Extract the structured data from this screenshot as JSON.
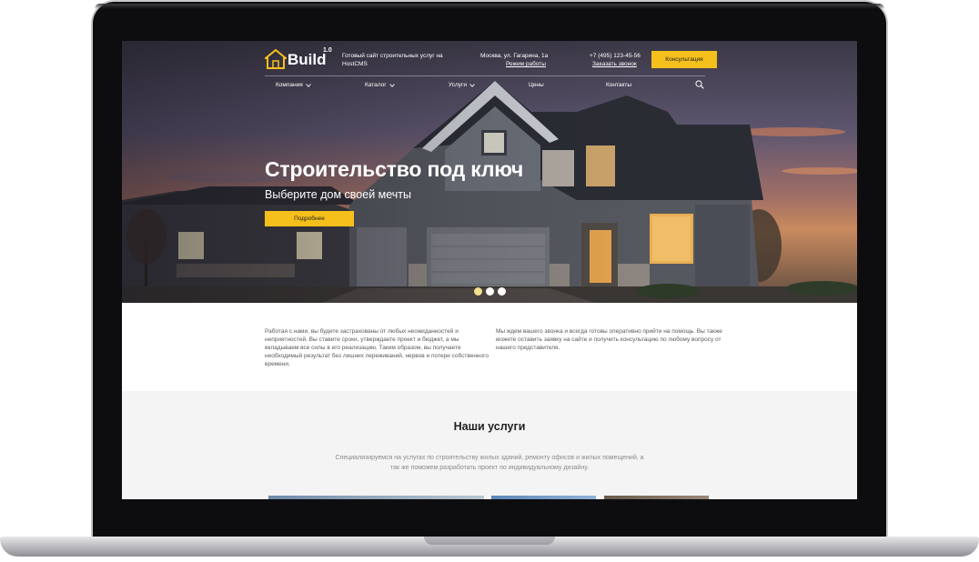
{
  "header": {
    "logo_text": "Build",
    "logo_version": "1.0",
    "tagline": "Готовый сайт строительных услуг на HostCMS",
    "address": "Москва, ул. Гагарина, 1а",
    "hours_link": "Режим работы",
    "phone": "+7 (495) 123-45-56",
    "callback_link": "Заказать звонок",
    "consult_label": "Консультация"
  },
  "nav": {
    "items": [
      {
        "label": "Компания",
        "dropdown": true
      },
      {
        "label": "Каталог",
        "dropdown": true
      },
      {
        "label": "Услуги",
        "dropdown": true
      },
      {
        "label": "Цены",
        "dropdown": false
      },
      {
        "label": "Контакты",
        "dropdown": false
      }
    ]
  },
  "hero": {
    "title": "Строительство под ключ",
    "subtitle": "Выберите дом своей мечты",
    "button_label": "Подробнее",
    "slides": 3,
    "active_slide": 1
  },
  "intro": {
    "left": "Работая с нами, вы будете застрахованы от любых неожиданностей и неприятностей. Вы ставите сроки, утверждаете проект и бюджет, а мы вкладываем все силы в его реализацию. Таким образом, вы получаете необходимый результат без лишних переживаний, нервов и потери собственного времени.",
    "right": "Мы ждем вашего звонка и всегда готовы оперативно прийти на помощь. Вы также можете оставить заявку на сайте и получить консультацию по любому вопросу от нашего представителя."
  },
  "services": {
    "title": "Наши услуги",
    "description": "Специализируемся на услугах по строительству жилых зданий, ремонту офисов и жилых помещений, а так же поможем разработать проект по индивидуальному дизайну."
  },
  "colors": {
    "accent": "#f5c01c",
    "services_bg": "#f4f4f4",
    "frame": "#0d0d0f"
  },
  "icons": {
    "logo": "house-outline-icon",
    "search": "search-icon",
    "dropdown": "chevron-down-icon"
  }
}
